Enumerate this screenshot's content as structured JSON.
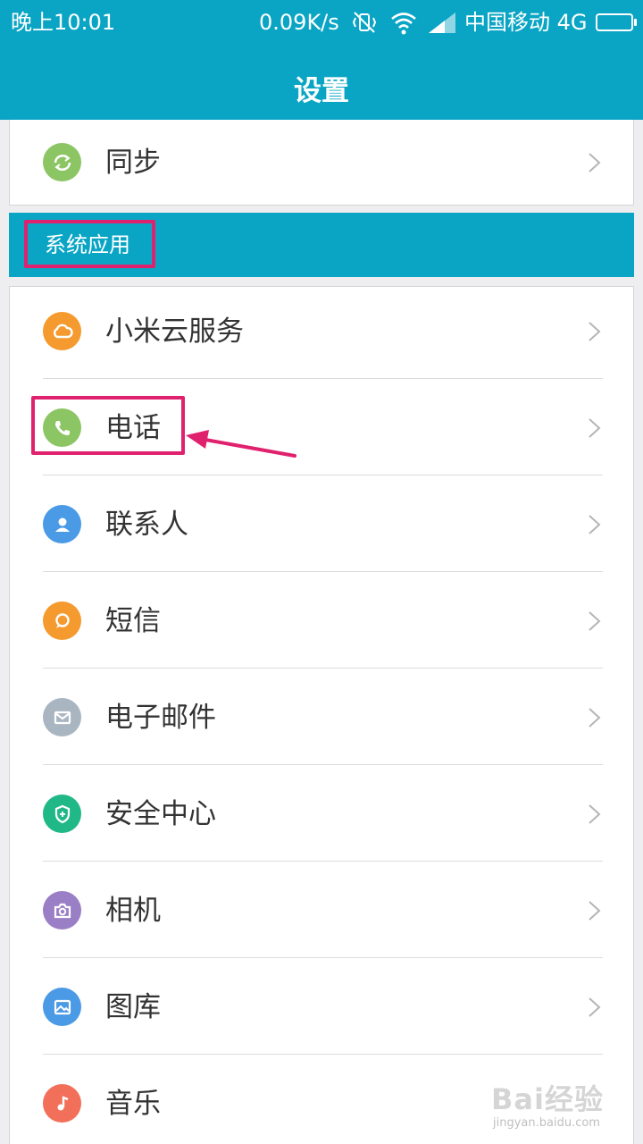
{
  "status_bar": {
    "time": "晚上10:01",
    "network_speed": "0.09K/s",
    "carrier": "中国移动 4G",
    "icons": [
      "vibrate-off-icon",
      "wifi-icon",
      "signal-icon",
      "battery-icon"
    ]
  },
  "header": {
    "title": "设置"
  },
  "sync_item": {
    "label": "同步",
    "icon": "sync-icon",
    "icon_color": "#8cc564"
  },
  "section": {
    "title": "系统应用",
    "color": "#0aa5c5"
  },
  "items": [
    {
      "label": "小米云服务",
      "icon": "cloud-icon",
      "icon_color": "#f59a2f"
    },
    {
      "label": "电话",
      "icon": "phone-icon",
      "icon_color": "#8cc564"
    },
    {
      "label": "联系人",
      "icon": "contact-icon",
      "icon_color": "#4a9ae6"
    },
    {
      "label": "短信",
      "icon": "message-icon",
      "icon_color": "#f59a2f"
    },
    {
      "label": "电子邮件",
      "icon": "email-icon",
      "icon_color": "#a9b6c2"
    },
    {
      "label": "安全中心",
      "icon": "shield-icon",
      "icon_color": "#21b887"
    },
    {
      "label": "相机",
      "icon": "camera-icon",
      "icon_color": "#9b7fc6"
    },
    {
      "label": "图库",
      "icon": "gallery-icon",
      "icon_color": "#4a9ae6"
    },
    {
      "label": "音乐",
      "icon": "music-icon",
      "icon_color": "#f2705a"
    }
  ],
  "annotation": {
    "highlight_color": "#e0216d"
  },
  "watermark": {
    "text": "Bai经验",
    "url": "jingyan.baidu.com"
  }
}
